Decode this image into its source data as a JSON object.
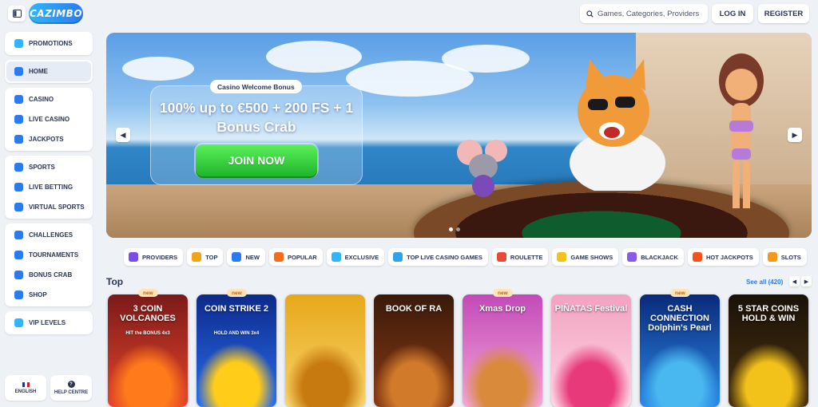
{
  "header": {
    "logo_text": "CAZIMBO",
    "search_placeholder": "Games, Categories, Providers",
    "login_label": "LOG IN",
    "register_label": "REGISTER"
  },
  "sidebar": {
    "groups": [
      [
        {
          "label": "PROMOTIONS",
          "icon": "gift-icon",
          "color": "#2fb6ff"
        }
      ],
      [
        {
          "label": "HOME",
          "icon": "home-icon",
          "color": "#2a7bf0",
          "active": true
        }
      ],
      [
        {
          "label": "CASINO",
          "icon": "casino-icon",
          "color": "#2a7bf0"
        },
        {
          "label": "LIVE CASINO",
          "icon": "live-casino-icon",
          "color": "#2a7bf0"
        },
        {
          "label": "JACKPOTS",
          "icon": "jackpot-icon",
          "color": "#2a7bf0"
        }
      ],
      [
        {
          "label": "SPORTS",
          "icon": "sports-icon",
          "color": "#2a7bf0"
        },
        {
          "label": "LIVE BETTING",
          "icon": "live-betting-icon",
          "color": "#2a7bf0"
        },
        {
          "label": "VIRTUAL SPORTS",
          "icon": "virtual-sports-icon",
          "color": "#2a7bf0"
        }
      ],
      [
        {
          "label": "CHALLENGES",
          "icon": "challenges-icon",
          "color": "#2a7bf0"
        },
        {
          "label": "TOURNAMENTS",
          "icon": "trophy-icon",
          "color": "#2a7bf0"
        },
        {
          "label": "BONUS CRAB",
          "icon": "crab-icon",
          "color": "#2a7bf0"
        },
        {
          "label": "SHOP",
          "icon": "shop-icon",
          "color": "#2a7bf0"
        }
      ],
      [
        {
          "label": "VIP LEVELS",
          "icon": "diamond-icon",
          "color": "#2fb6ff"
        }
      ]
    ],
    "language_label": "ENGLISH",
    "help_label": "HELP CENTRE"
  },
  "banner": {
    "tag": "Casino Welcome Bonus",
    "title": "100% up to €500 + 200 FS + 1 Bonus Crab",
    "cta": "JOIN NOW",
    "slides_total": 2,
    "active_slide": 1
  },
  "categories": [
    {
      "label": "PROVIDERS",
      "icon": "providers-icon",
      "color": "#7a4de8"
    },
    {
      "label": "TOP",
      "icon": "top-icon",
      "color": "#f3a21b"
    },
    {
      "label": "NEW",
      "icon": "new-icon",
      "color": "#2a7bf0"
    },
    {
      "label": "POPULAR",
      "icon": "popular-icon",
      "color": "#f36d1b"
    },
    {
      "label": "EXCLUSIVE",
      "icon": "exclusive-icon",
      "color": "#2fb6ff"
    },
    {
      "label": "TOP LIVE CASINO GAMES",
      "icon": "live-casino-games-icon",
      "color": "#2fa2e8"
    },
    {
      "label": "ROULETTE",
      "icon": "roulette-icon",
      "color": "#e84a3a"
    },
    {
      "label": "GAME SHOWS",
      "icon": "game-shows-icon",
      "color": "#f3c21b"
    },
    {
      "label": "BLACKJACK",
      "icon": "blackjack-icon",
      "color": "#8a5be8"
    },
    {
      "label": "HOT JACKPOTS",
      "icon": "hot-jackpots-icon",
      "color": "#f3531b"
    },
    {
      "label": "SLOTS",
      "icon": "slots-icon",
      "color": "#f39a1b"
    }
  ],
  "top_section": {
    "title": "Top",
    "see_all": "See all (420)"
  },
  "games": [
    {
      "name": "3 COIN VOLCANOES",
      "sub": "HIT the BONUS 4x3",
      "new": true,
      "bg1": "#7a1a1a",
      "bg2": "#e8452a",
      "art": "#ff7a1a"
    },
    {
      "name": "COIN STRIKE 2",
      "sub": "HOLD AND WIN 3x4",
      "new": true,
      "bg1": "#0d2a8a",
      "bg2": "#2a6ef0",
      "art": "#ffcc1a"
    },
    {
      "name": "",
      "sub": "",
      "new": false,
      "bg1": "#e8a81a",
      "bg2": "#f7d36a",
      "art": "#c77a10"
    },
    {
      "name": "BOOK OF RA",
      "sub": "",
      "new": false,
      "bg1": "#3a1a0a",
      "bg2": "#8a3a14",
      "art": "#d07a2a"
    },
    {
      "name": "Xmas Drop",
      "sub": "",
      "new": true,
      "bg1": "#c24ab8",
      "bg2": "#f5a6d8",
      "art": "#d98a3a"
    },
    {
      "name": "PIÑATAS Festival",
      "sub": "",
      "new": false,
      "bg1": "#f2a2c0",
      "bg2": "#ffd5e3",
      "art": "#e83a7a"
    },
    {
      "name": "CASH CONNECTION Dolphin's Pearl",
      "sub": "",
      "new": true,
      "bg1": "#0a2a7a",
      "bg2": "#2a8ae8",
      "art": "#4ab8f0"
    },
    {
      "name": "5 STAR COINS HOLD & WIN",
      "sub": "",
      "new": false,
      "bg1": "#1a1208",
      "bg2": "#4a3210",
      "art": "#f2c21a"
    }
  ]
}
